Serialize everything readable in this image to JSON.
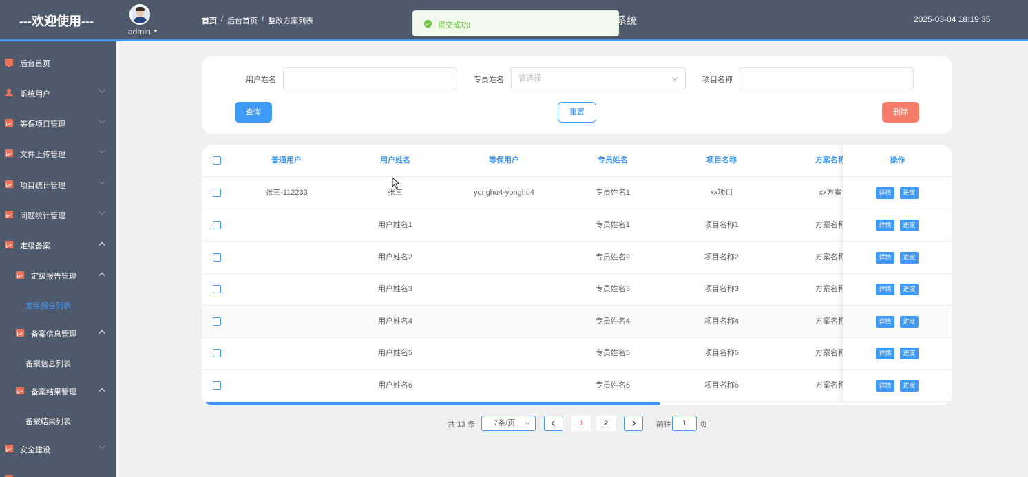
{
  "header": {
    "welcome": "---欢迎使用---",
    "user": "admin",
    "breadcrumb": [
      "首页",
      "后台首页",
      "整改方案列表"
    ],
    "system_title_suffix": "系统",
    "datetime": "2025-03-04 18:19:35"
  },
  "toast": {
    "message": "提交成功!",
    "icon": "success-check-icon"
  },
  "sidebar": {
    "items": [
      {
        "label": "后台首页",
        "icon": "monitor-icon"
      },
      {
        "label": "系统用户",
        "icon": "user-icon"
      },
      {
        "label": "等保项目管理",
        "icon": "chart-icon"
      },
      {
        "label": "文件上传管理",
        "icon": "chart-icon"
      },
      {
        "label": "项目统计管理",
        "icon": "chart-icon"
      },
      {
        "label": "问题统计管理",
        "icon": "chart-icon"
      },
      {
        "label": "定级备案",
        "icon": "chart-icon"
      },
      {
        "label": "定级报告管理",
        "icon": "chart-icon"
      },
      {
        "label": "定级报告列表"
      },
      {
        "label": "备案信息管理",
        "icon": "chart-icon"
      },
      {
        "label": "备案信息列表"
      },
      {
        "label": "备案结果管理",
        "icon": "chart-icon"
      },
      {
        "label": "备案结果列表"
      },
      {
        "label": "安全建设",
        "icon": "chart-icon"
      }
    ]
  },
  "search": {
    "user_name_label": "用户姓名",
    "user_name_value": "",
    "staff_name_label": "专员姓名",
    "staff_name_placeholder": "请选择",
    "project_name_label": "项目名称",
    "project_name_value": "",
    "query_label": "查询",
    "reset_label": "重置",
    "delete_label": "删除"
  },
  "table": {
    "headers": [
      "普通用户",
      "用户姓名",
      "等保用户",
      "专员姓名",
      "项目名称",
      "方案名称"
    ],
    "action_header": "操作",
    "detail_label": "详情",
    "progress_label": "进度",
    "rows": [
      [
        "张三-112233",
        "张三",
        "yonghu4-yonghu4",
        "专员姓名1",
        "xx项目",
        "xx方案"
      ],
      [
        "",
        "用户姓名1",
        "",
        "专员姓名1",
        "项目名称1",
        "方案名称"
      ],
      [
        "",
        "用户姓名2",
        "",
        "专员姓名2",
        "项目名称2",
        "方案名称"
      ],
      [
        "",
        "用户姓名3",
        "",
        "专员姓名3",
        "项目名称3",
        "方案名称"
      ],
      [
        "",
        "用户姓名4",
        "",
        "专员姓名4",
        "项目名称4",
        "方案名称"
      ],
      [
        "",
        "用户姓名5",
        "",
        "专员姓名5",
        "项目名称5",
        "方案名称"
      ],
      [
        "",
        "用户姓名6",
        "",
        "专员姓名6",
        "项目名称6",
        "方案名称"
      ]
    ]
  },
  "pagination": {
    "total": "共 13 条",
    "page_size": "7条/页",
    "pages": [
      "1",
      "2"
    ],
    "current": "1",
    "goto_label": "前往",
    "goto_value": "1",
    "page_suffix": "页"
  },
  "colors": {
    "header_bg": "#4e5a6c",
    "accent": "#3f9af6",
    "danger": "#f67c6a",
    "icon": "#e8735d"
  }
}
